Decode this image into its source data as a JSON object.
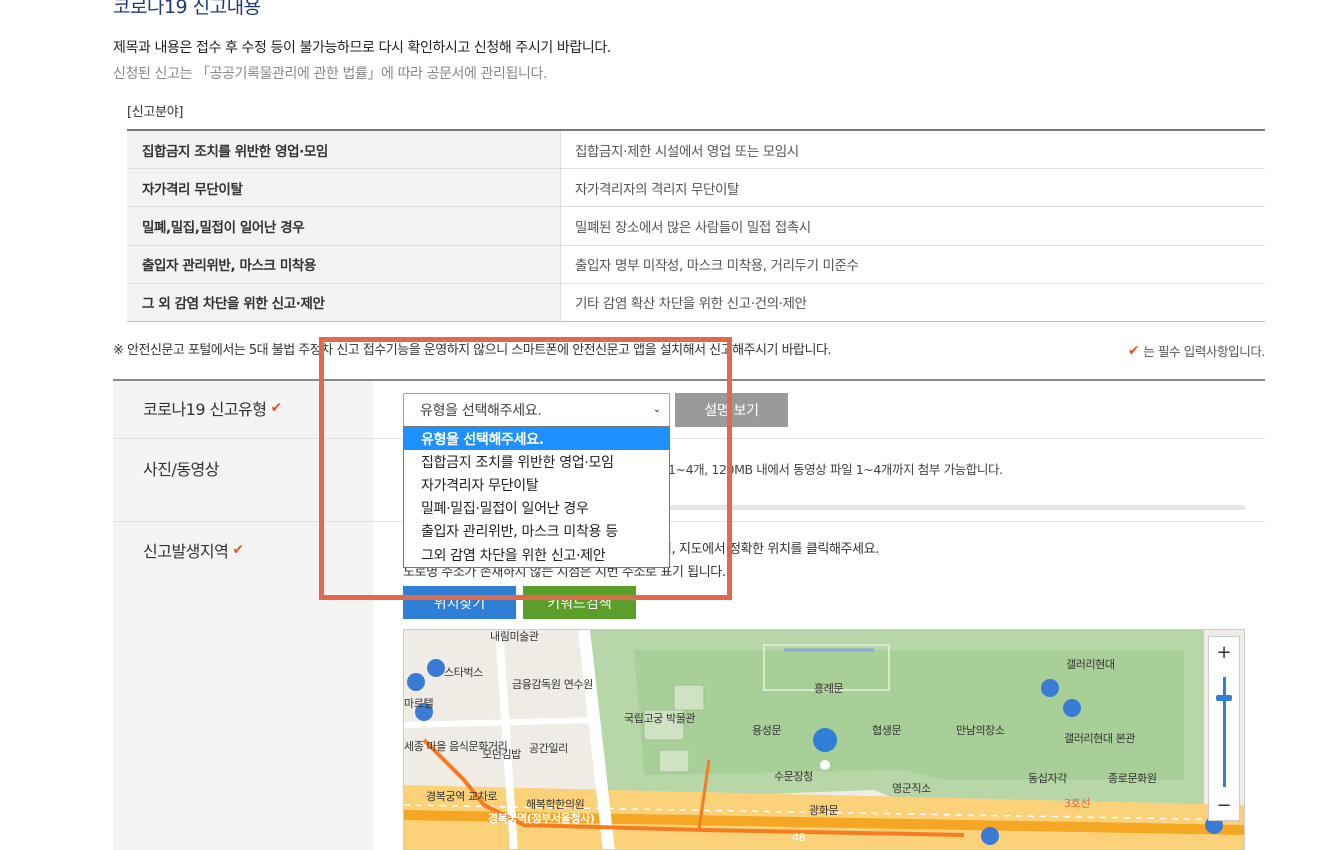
{
  "header": {
    "title": "코로나19 신고내용",
    "notice1": "제목과 내용은 접수 후 수정 등이 불가능하므로 다시 확인하시고 신청해 주시기 바랍니다.",
    "notice2": "신청된 신고는 「공공기록물관리에 관한 법률」에 따라 공문서에 관리됩니다."
  },
  "categories": {
    "title": "[신고분야]",
    "rows": [
      {
        "name": "집합금지 조치를 위반한 영업·모임",
        "desc": "집합금지·제한 시설에서 영업 또는 모임시"
      },
      {
        "name": "자가격리 무단이탈",
        "desc": "자가격리자의 격리지 무단이탈"
      },
      {
        "name": "밀폐,밀집,밀접이 일어난 경우",
        "desc": "밀폐된 장소에서 많은 사람들이 밀접 접촉시"
      },
      {
        "name": "출입자 관리위반, 마스크 미착용",
        "desc": "출입자 명부 미작성, 마스크 미착용, 거리두기 미준수"
      },
      {
        "name": "그 외 감염 차단을 위한 신고·제안",
        "desc": "기타 감염 확산 차단을 위한 신고·건의·제안"
      }
    ]
  },
  "warning": "※ 안전신문고 포털에서는 5대 불법 주정차 신고 접수기능을 운영하지 않으니 스마트폰에 안전신문고 앱을 설치해서 신고해주시기 바랍니다.",
  "required_note": "는 필수 입력사항입니다.",
  "form": {
    "type_label": "코로나19 신고유형",
    "select_value": "유형을 선택해주세요.",
    "desc_button": "설명 보기",
    "options": [
      "유형을 선택해주세요.",
      "집합금지 조치를 위반한 영업·모임",
      "자가격리자 무단이탈",
      "밀폐·밀집·밀접이 일어난 경우",
      "출입자 관리위반, 마스크 미착용 등",
      "그외 감염 차단을 위한 신고·제안"
    ],
    "photo_label": "사진/동영상",
    "photo_text": "1~4개, 120MB 내에서 동영상 파일 1~4개까지 첨부 가능합니다.",
    "location_label": "신고발생지역",
    "loc_text1": "뒤, 지도에서 정확한 위치를 클릭해주세요.",
    "loc_text2": "도로명 주소가 존재하지 않는 지점은 지번 주소로 표기 됩니다.",
    "find_location_button": "위치찾기",
    "keyword_search_button": "키워드검색"
  },
  "map": {
    "labels": {
      "gallery": "내림미술관",
      "starbucks": "스타벅스",
      "fss": "금융감독원 연수원",
      "martel": "마르텔",
      "museum": "국립고궁 박물관",
      "heungryemun": "흥례문",
      "yongseongmun": "용성문",
      "hyeopsaengmun": "협생문",
      "mannim": "만남의장소",
      "gallery_hyundai": "갤러리현대",
      "gallery_hyundai_annex": "갤러리현대 본관",
      "modern_gimbap": "모던김밥",
      "gonggan": "공간일리",
      "culture_street": "세종 마을 음식문화거리",
      "sumunjang": "수문장청",
      "yeonggunjiso": "영군직소",
      "dongsip": "동십자각",
      "jongno_hall": "종로문화원",
      "gwanghwamun": "광화문",
      "gyeongbokgung_junction": "경복궁역 교차로",
      "haebokhan": "해복학한의원",
      "station": "경복궁역(정부서울청사)",
      "line3": "3호선",
      "route48": "48"
    },
    "zoom_in": "+",
    "zoom_out": "−",
    "zoom_level": 0.85
  },
  "colors": {
    "accent": "#e8512a",
    "title": "#1f3a7a",
    "find_button": "#2f7fd6",
    "keyword_button": "#5b9e2a",
    "highlight": "#e06a4b",
    "selected_option": "#1e90ff"
  }
}
